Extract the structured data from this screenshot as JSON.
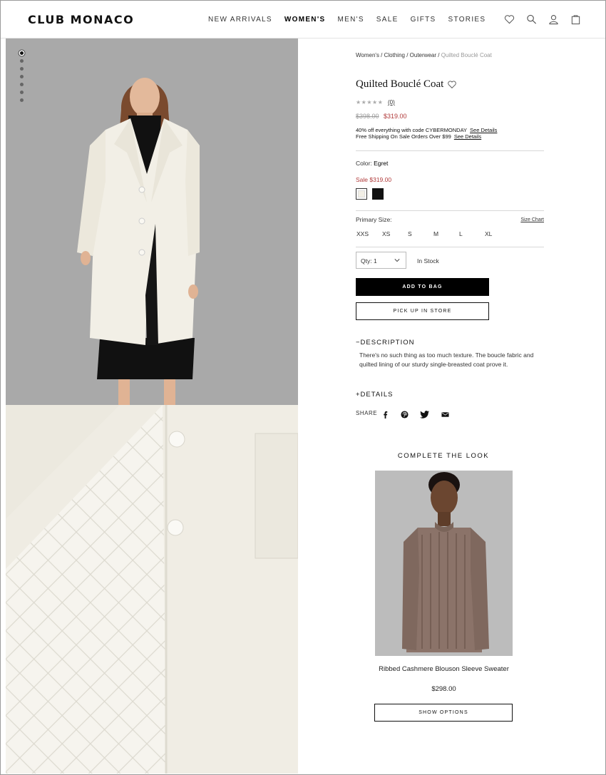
{
  "brand": {
    "logo_text": "CLUB MONACO"
  },
  "nav": {
    "items": [
      {
        "label": "NEW ARRIVALS"
      },
      {
        "label": "WOMEN'S"
      },
      {
        "label": "MEN'S"
      },
      {
        "label": "SALE"
      },
      {
        "label": "GIFTS"
      },
      {
        "label": "STORIES"
      }
    ],
    "active_index": 1
  },
  "header_icons": [
    "heart-icon",
    "search-icon",
    "account-icon",
    "bag-icon"
  ],
  "gallery": {
    "dot_count": 7,
    "active_dot": 0
  },
  "breadcrumb": {
    "items": [
      "Women's",
      "Clothing",
      "Outerwear"
    ],
    "separator": " / ",
    "current": "Quilted Bouclé Coat"
  },
  "product": {
    "title": "Quilted Bouclé Coat",
    "stars": "★★★★★",
    "review_count": "(0)",
    "original_price": "$398.00",
    "sale_price": "$319.00",
    "promo_line1": "40% off everything with code CYBERMONDAY",
    "promo_line2": "Free Shipping On Sale Orders Over $99",
    "see_details": "See Details",
    "color_label": "Color:",
    "color_value": "Egret",
    "sale_label": "Sale $319.00",
    "swatches": [
      {
        "name": "Egret",
        "color": "#f2efe6",
        "selected": true
      },
      {
        "name": "Black",
        "color": "#111111",
        "selected": false
      }
    ],
    "size_label": "Primary Size:",
    "size_chart": "Size Chart",
    "sizes": [
      "XXS",
      "XS",
      "S",
      "M",
      "L",
      "XL"
    ],
    "qty_label": "Qty: 1",
    "stock_status": "In Stock",
    "add_to_bag": "ADD TO BAG",
    "pick_up": "PICK UP IN STORE",
    "description_heading": "−DESCRIPTION",
    "description_text": "There's no such thing as too much texture. The boucle fabric and quilted lining of our sturdy single-breasted coat prove it.",
    "details_heading": "+DETAILS",
    "share_label": "SHARE",
    "share_icons": [
      "facebook-icon",
      "pinterest-icon",
      "twitter-icon",
      "email-icon"
    ]
  },
  "complete_the_look": {
    "heading": "COMPLETE THE LOOK",
    "item_name": "Ribbed Cashmere Blouson Sleeve Sweater",
    "item_price": "$298.00",
    "button": "SHOW OPTIONS"
  },
  "colors": {
    "sale_red": "#b03a3a",
    "photo_bg": "#a7a7a7",
    "coat": "#f2efe6"
  }
}
